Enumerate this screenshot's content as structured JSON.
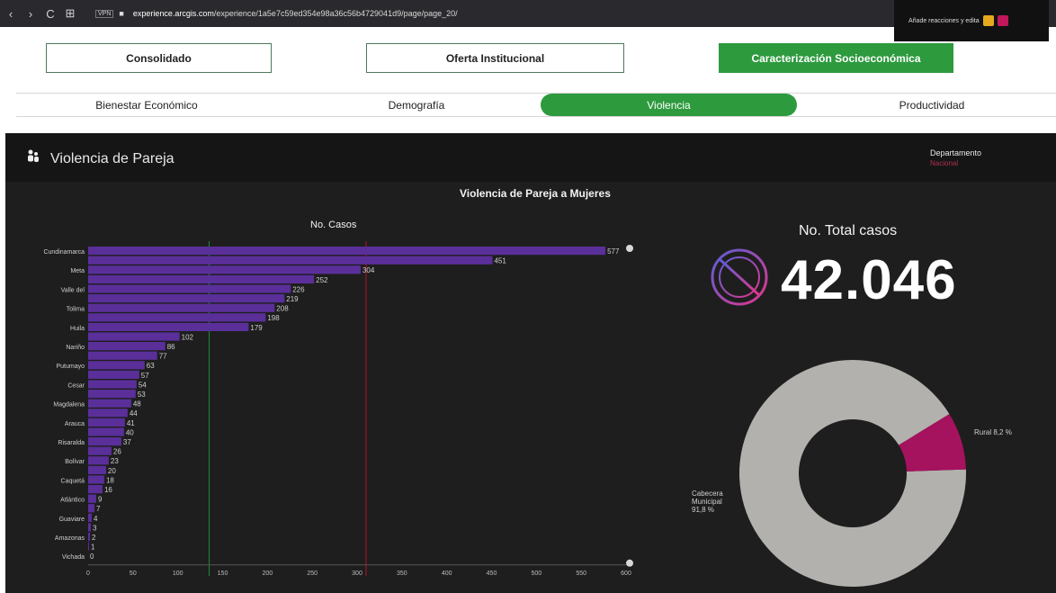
{
  "browser": {
    "back": "‹",
    "forward": "›",
    "reload": "C",
    "apps": "⊞",
    "vpn": "VPN",
    "url_host": "experience.arcgis.com",
    "url_path": "/experience/1a5e7c59ed354e98a36c56b4729041d9/page/page_20/",
    "extension_text": "Añade reacciones y edita"
  },
  "nav": {
    "buttons": [
      {
        "label": "Consolidado",
        "active": false
      },
      {
        "label": "Oferta Institucional",
        "active": false
      },
      {
        "label": "Caracterización Socioeconómica",
        "active": true
      }
    ]
  },
  "tabs": [
    {
      "label": "Bienestar Económico",
      "active": false
    },
    {
      "label": "Demografía",
      "active": false
    },
    {
      "label": "Violencia",
      "active": true
    },
    {
      "label": "Productividad",
      "active": false
    }
  ],
  "dashboard": {
    "title": "Violencia de Pareja",
    "icon": "people-group-icon",
    "filter_label": "Departamento",
    "filter_value": "Nacional",
    "chart_title": "Violencia de Pareja a Mujeres",
    "chart_subtitle": "No. Casos",
    "total_label": "No. Total casos",
    "total_value": "42.046",
    "total_icon": "female-no-violence-icon"
  },
  "colors": {
    "accent_green": "#2d9a3e",
    "bar_purple": "#5a2f9a",
    "donut_gray": "#b3b1ad",
    "donut_magenta": "#a5125e",
    "marker_green": "#1f8a3a",
    "marker_red": "#b3122a"
  },
  "chart_data": [
    {
      "type": "bar",
      "orientation": "horizontal",
      "title": "No. Casos",
      "categories": [
        "Cundinamarca",
        "",
        "Meta",
        "",
        "Valle del Cauca",
        "",
        "Tolima",
        "",
        "Huila",
        "",
        "Nariño",
        "",
        "Putumayo",
        "",
        "Cesar",
        "",
        "Magdalena",
        "",
        "Arauca",
        "",
        "Risaralda",
        "",
        "Bolívar",
        "",
        "Caquetá",
        "",
        "Atlántico",
        "",
        "Guaviare",
        "",
        "Amazonas",
        "",
        "Vichada"
      ],
      "values": [
        577,
        451,
        304,
        252,
        226,
        219,
        208,
        198,
        179,
        102,
        86,
        77,
        63,
        57,
        54,
        53,
        48,
        44,
        41,
        40,
        37,
        26,
        23,
        20,
        18,
        16,
        9,
        7,
        4,
        3,
        2,
        1,
        0
      ],
      "xlim": [
        0,
        600
      ],
      "xticks": [
        0,
        50,
        100,
        150,
        200,
        250,
        300,
        350,
        400,
        450,
        500,
        550,
        600
      ],
      "grid": false
    },
    {
      "type": "pie",
      "style": "donut",
      "slices": [
        {
          "label": "Cabecera Municipal",
          "percent_text": "91,8 %",
          "value": 91.8
        },
        {
          "label": "Rural",
          "percent_text": "8,2 %",
          "value": 8.2
        }
      ]
    }
  ]
}
